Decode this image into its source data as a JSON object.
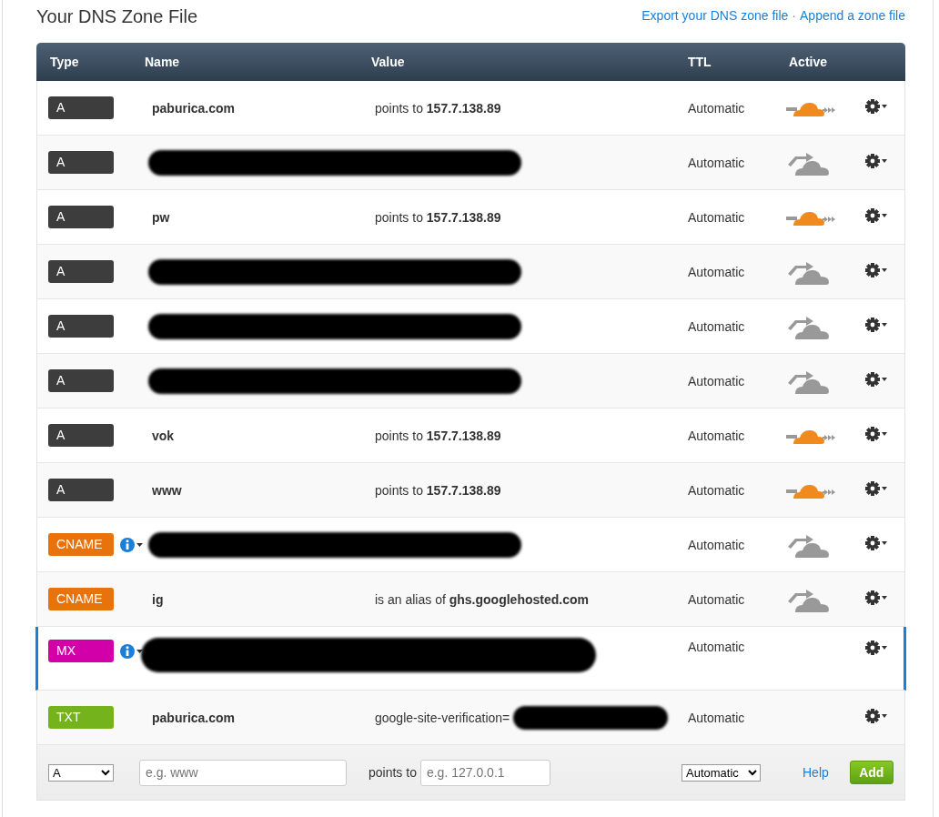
{
  "title": "Your DNS Zone File",
  "links": [
    {
      "label": "Export your DNS zone file"
    },
    {
      "label": "Append a zone file"
    }
  ],
  "link_separator": "·",
  "table": {
    "columns": [
      "Type",
      "Name",
      "Value",
      "TTL",
      "Active"
    ],
    "rows": [
      {
        "type": "A",
        "color": "#3d3d3d",
        "name": "paburica.com",
        "value": "points to **157.7.138.89**",
        "ttl": "Automatic",
        "proxied": true,
        "redacted": false,
        "info": false,
        "selected": false
      },
      {
        "type": "A",
        "color": "#3d3d3d",
        "ttl": "Automatic",
        "proxied": false,
        "redacted": true,
        "info": false,
        "selected": false
      },
      {
        "type": "A",
        "color": "#3d3d3d",
        "name": "pw",
        "value": "points to **157.7.138.89**",
        "ttl": "Automatic",
        "proxied": true,
        "redacted": false,
        "info": false,
        "selected": false
      },
      {
        "type": "A",
        "color": "#3d3d3d",
        "ttl": "Automatic",
        "proxied": false,
        "redacted": true,
        "info": false,
        "selected": false
      },
      {
        "type": "A",
        "color": "#3d3d3d",
        "ttl": "Automatic",
        "proxied": false,
        "redacted": true,
        "info": false,
        "selected": false
      },
      {
        "type": "A",
        "color": "#3d3d3d",
        "ttl": "Automatic",
        "proxied": false,
        "redacted": true,
        "info": false,
        "selected": false
      },
      {
        "type": "A",
        "color": "#3d3d3d",
        "name": "vok",
        "value": "points to **157.7.138.89**",
        "ttl": "Automatic",
        "proxied": true,
        "redacted": false,
        "info": false,
        "selected": false
      },
      {
        "type": "A",
        "color": "#3d3d3d",
        "name": "www",
        "value": "points to **157.7.138.89**",
        "ttl": "Automatic",
        "proxied": true,
        "redacted": false,
        "info": false,
        "selected": false
      },
      {
        "type": "CNAME",
        "color": "#e8730c",
        "ttl": "Automatic",
        "proxied": false,
        "redacted": true,
        "info": true,
        "selected": false
      },
      {
        "type": "CNAME",
        "color": "#e8730c",
        "name": "ig",
        "value": "is an alias of **ghs.googlehosted.com**",
        "ttl": "Automatic",
        "proxied": false,
        "redacted": false,
        "info": false,
        "selected": false
      },
      {
        "type": "MX",
        "color": "#d100a8",
        "ttl": "Automatic",
        "redacted": true,
        "info": true,
        "selected": true
      },
      {
        "type": "TXT",
        "color": "#74b31c",
        "name": "paburica.com",
        "value": "google-site-verification=",
        "value_redacted": true,
        "ttl": "Automatic",
        "redacted": false,
        "info": false,
        "selected": false
      }
    ]
  },
  "add_form": {
    "type": "A",
    "name_placeholder": "e.g. www",
    "value_label": "points to",
    "value_placeholder": "e.g. 127.0.0.1",
    "ttl": "Automatic",
    "help": "Help",
    "button": "Add"
  }
}
